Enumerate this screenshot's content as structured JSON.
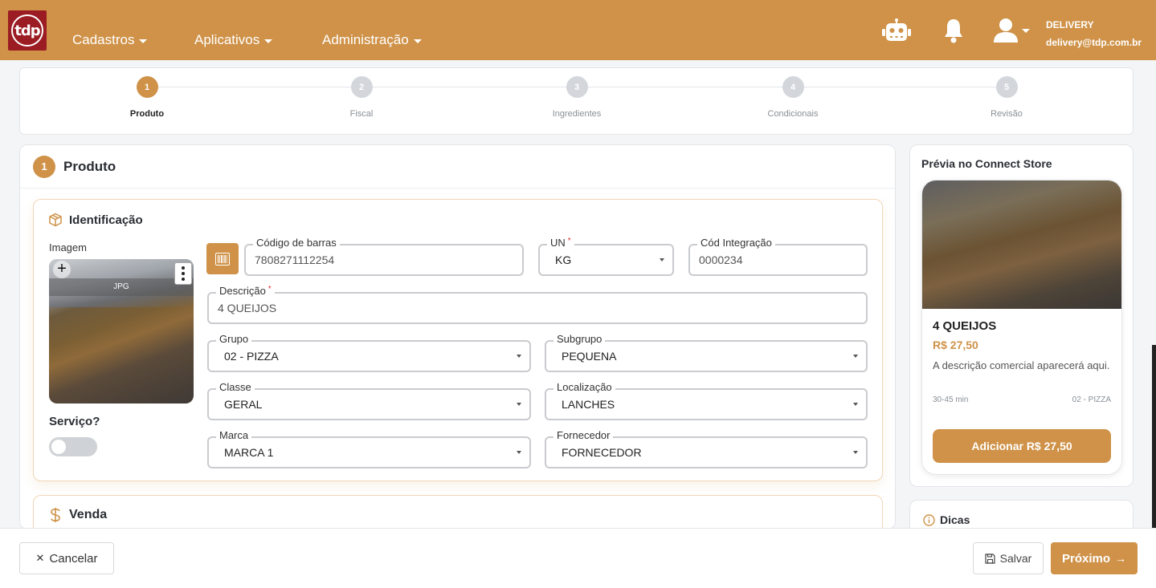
{
  "header": {
    "logo_text": "tdp",
    "nav": [
      "Cadastros",
      "Aplicativos",
      "Administração"
    ],
    "user_name": "DELIVERY",
    "user_email": "delivery@tdp.com.br",
    "icons": [
      "robot-icon",
      "bell-icon",
      "user-icon"
    ]
  },
  "stepper": {
    "steps": [
      {
        "num": "1",
        "label": "Produto",
        "active": true
      },
      {
        "num": "2",
        "label": "Fiscal",
        "active": false
      },
      {
        "num": "3",
        "label": "Ingredientes",
        "active": false
      },
      {
        "num": "4",
        "label": "Condicionais",
        "active": false
      },
      {
        "num": "5",
        "label": "Revisão",
        "active": false
      }
    ]
  },
  "main": {
    "num": "1",
    "title": "Produto",
    "identificacao": {
      "title": "Identificação",
      "image_label": "Imagem",
      "image_tag": "JPG",
      "servico_label": "Serviço?",
      "servico_on": false,
      "fields": {
        "codigo_barras": {
          "label": "Código de barras",
          "value": "7808271112254"
        },
        "un": {
          "label": "UN",
          "required": "*",
          "value": "KG"
        },
        "cod_integracao": {
          "label": "Cód Integração",
          "value": "0000234"
        },
        "descricao": {
          "label": "Descrição",
          "required": "*",
          "value": "4 QUEIJOS"
        },
        "grupo": {
          "label": "Grupo",
          "value": "02 - PIZZA"
        },
        "subgrupo": {
          "label": "Subgrupo",
          "value": "PEQUENA"
        },
        "classe": {
          "label": "Classe",
          "value": "GERAL"
        },
        "localizacao": {
          "label": "Localização",
          "value": "LANCHES"
        },
        "marca": {
          "label": "Marca",
          "value": "MARCA 1"
        },
        "fornecedor": {
          "label": "Fornecedor",
          "value": "FORNECEDOR"
        }
      }
    },
    "venda": {
      "title": "Venda"
    }
  },
  "preview": {
    "title": "Prévia no Connect Store",
    "product_name": "4 QUEIJOS",
    "price": "R$ 27,50",
    "description": "A descrição comercial aparecerá aqui.",
    "time": "30-45 min",
    "category": "02 - PIZZA",
    "add_button": "Adicionar R$ 27,50"
  },
  "tips": {
    "title": "Dicas"
  },
  "footer": {
    "cancel": "Cancelar",
    "save": "Salvar",
    "next": "Próximo"
  },
  "colors": {
    "accent": "#cf9248",
    "brand_red": "#9b1c23"
  }
}
